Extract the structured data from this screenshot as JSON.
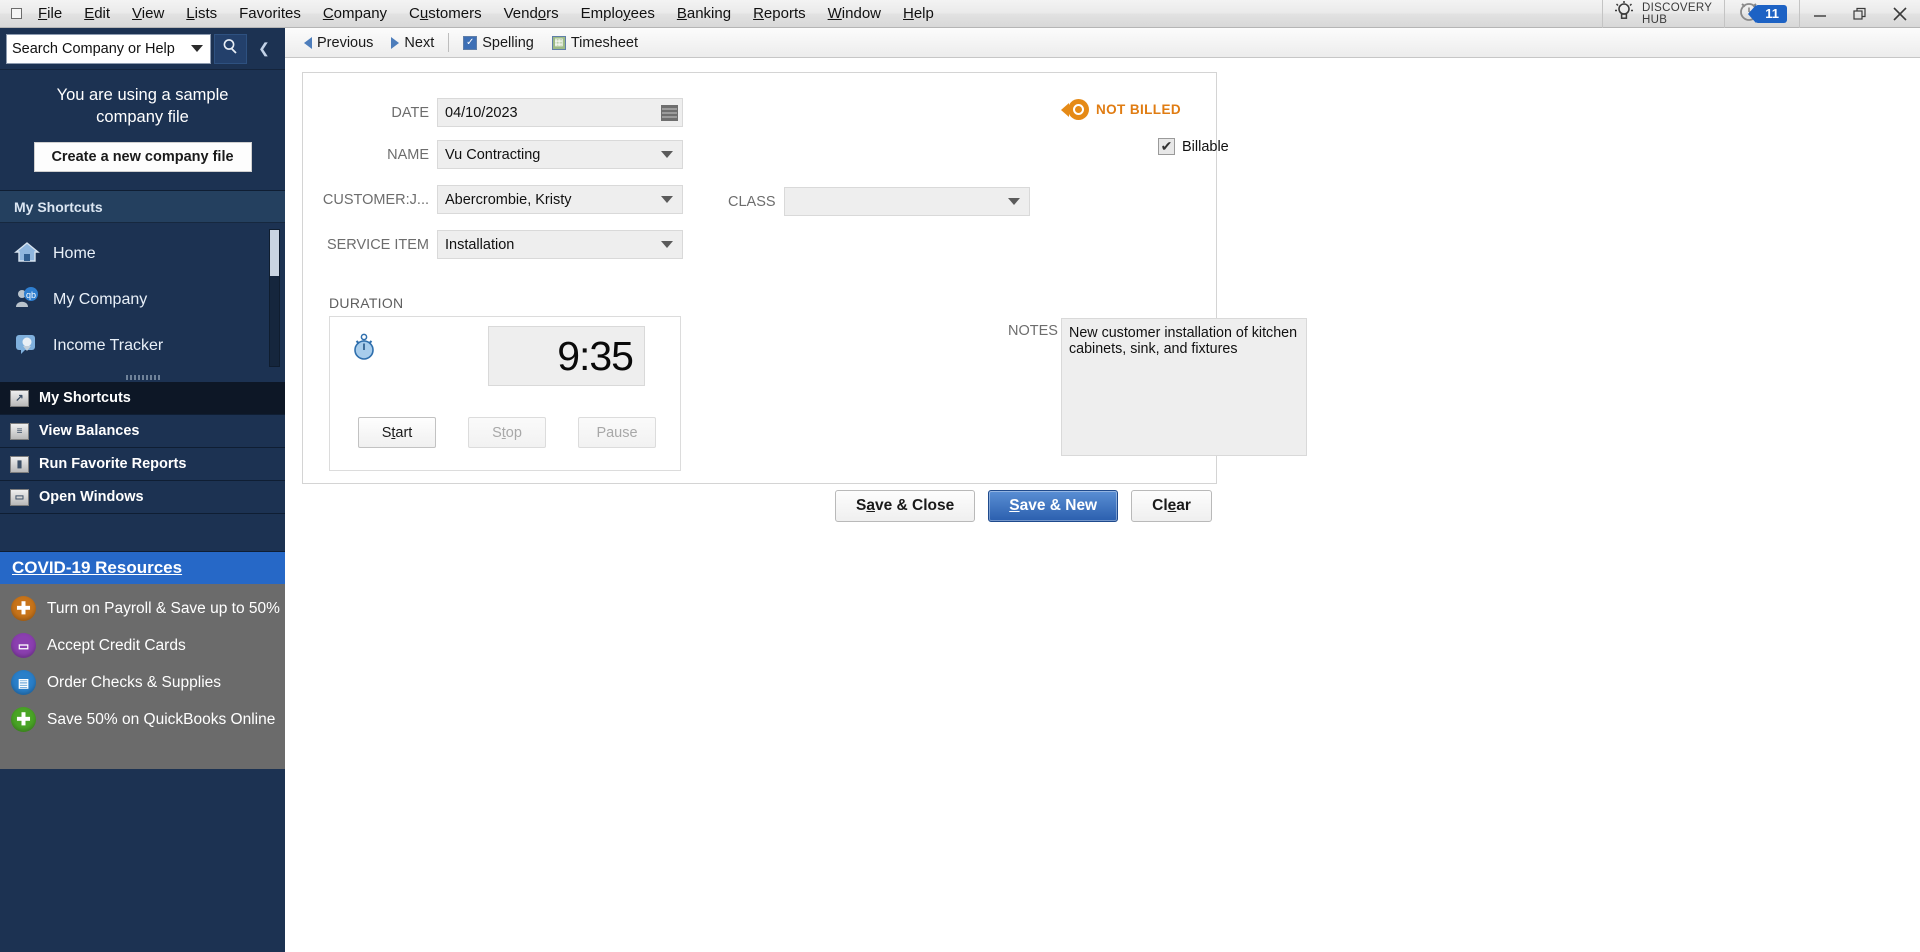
{
  "menubar": {
    "items": [
      {
        "label": "File",
        "mnemonic": "F"
      },
      {
        "label": "Edit",
        "mnemonic": "E"
      },
      {
        "label": "View",
        "mnemonic": "V"
      },
      {
        "label": "Lists",
        "mnemonic": "L"
      },
      {
        "label": "Favorites",
        "mnemonic": ""
      },
      {
        "label": "Company",
        "mnemonic": "C"
      },
      {
        "label": "Customers",
        "mnemonic": "u"
      },
      {
        "label": "Vendors",
        "mnemonic": "o"
      },
      {
        "label": "Employees",
        "mnemonic": "y"
      },
      {
        "label": "Banking",
        "mnemonic": "B"
      },
      {
        "label": "Reports",
        "mnemonic": "R"
      },
      {
        "label": "Window",
        "mnemonic": "W"
      },
      {
        "label": "Help",
        "mnemonic": "H"
      }
    ],
    "discovery_hub_line1": "DISCOVERY",
    "discovery_hub_line2": "HUB",
    "alarm_count": "11",
    "minimize": "—",
    "restore": "❐",
    "close": "✕"
  },
  "sidebar": {
    "search": {
      "placeholder": "Search Company or Help",
      "value": ""
    },
    "sample_banner": {
      "line1": "You are using a sample",
      "line2": "company file",
      "button_label": "Create a new company file"
    },
    "shortcuts_header": "My Shortcuts",
    "shortcuts": [
      {
        "label": "Home",
        "icon": "home-icon"
      },
      {
        "label": "My Company",
        "icon": "company-icon"
      },
      {
        "label": "Income Tracker",
        "icon": "income-tracker-icon"
      }
    ],
    "nav_items": [
      {
        "label": "My Shortcuts",
        "active": true
      },
      {
        "label": "View Balances",
        "active": false
      },
      {
        "label": "Run Favorite Reports",
        "active": false
      },
      {
        "label": "Open Windows",
        "active": false
      }
    ],
    "covid_link": "COVID-19 Resources",
    "promos": [
      {
        "label": "Turn on Payroll & Save up to 50%",
        "color": "#c8741a",
        "glyph": "✚"
      },
      {
        "label": "Accept Credit Cards",
        "color": "#8b3fb0",
        "glyph": "▭"
      },
      {
        "label": "Order Checks & Supplies",
        "color": "#2a7fc9",
        "glyph": "▤"
      },
      {
        "label": "Save 50% on QuickBooks Online",
        "color": "#4aa526",
        "glyph": "✚"
      }
    ]
  },
  "form_toolbar": {
    "previous": "Previous",
    "next": "Next",
    "spelling": "Spelling",
    "timesheet": "Timesheet"
  },
  "form": {
    "date": {
      "label": "DATE",
      "value": "04/10/2023"
    },
    "name": {
      "label": "NAME",
      "value": "Vu Contracting"
    },
    "customer_job": {
      "label": "CUSTOMER:J...",
      "value": "Abercrombie, Kristy"
    },
    "service_item": {
      "label": "SERVICE ITEM",
      "value": "Installation"
    },
    "class": {
      "label": "CLASS",
      "value": ""
    },
    "not_billed": "NOT BILLED",
    "billable": {
      "label": "Billable",
      "checked": true,
      "check_glyph": "✔"
    },
    "duration": {
      "label": "DURATION",
      "timer_value": "9:35",
      "start": "Start",
      "stop": "Stop",
      "pause": "Pause"
    },
    "notes": {
      "label": "NOTES",
      "value": "New customer installation of kitchen cabinets, sink, and fixtures"
    },
    "actions": {
      "save_close": "Save & Close",
      "save_new": "Save & New",
      "clear": "Clear"
    }
  },
  "colors": {
    "sidebar_bg": "#1c3252",
    "accent_blue": "#2668c7",
    "not_billed_orange": "#e07c12",
    "primary_button": "#2b5fae"
  }
}
